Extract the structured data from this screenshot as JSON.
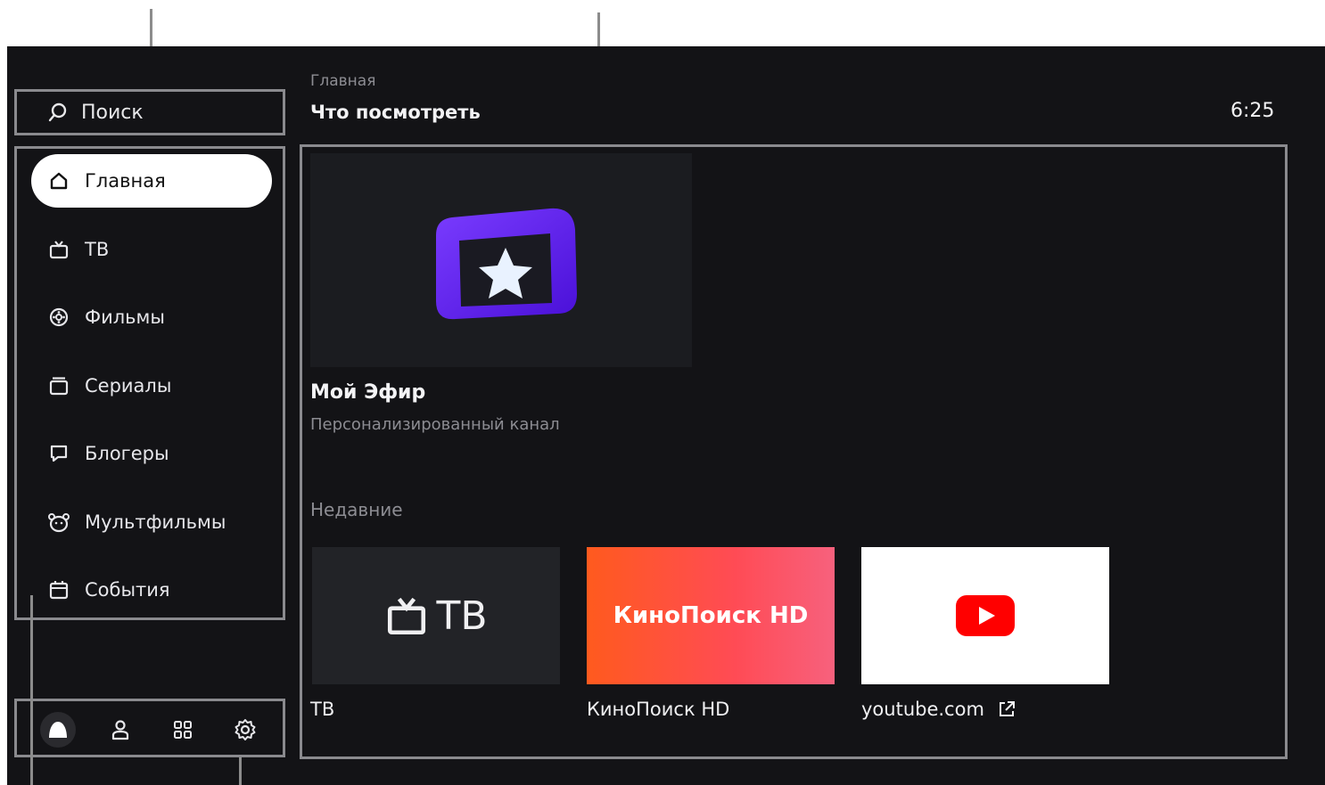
{
  "header": {
    "breadcrumb": "Главная",
    "title": "Что посмотреть",
    "clock": "6:25"
  },
  "search": {
    "label": "Поиск",
    "icon": "search-icon"
  },
  "sidebar": {
    "items": [
      {
        "label": "Главная",
        "icon": "home-icon",
        "active": true
      },
      {
        "label": "ТВ",
        "icon": "tv-icon"
      },
      {
        "label": "Фильмы",
        "icon": "film-reel-icon"
      },
      {
        "label": "Сериалы",
        "icon": "series-icon"
      },
      {
        "label": "Блогеры",
        "icon": "chat-bubble-icon"
      },
      {
        "label": "Мультфильмы",
        "icon": "bear-face-icon"
      },
      {
        "label": "События",
        "icon": "calendar-icon"
      }
    ]
  },
  "bottom_bar": {
    "buttons": [
      "account-avatar-icon",
      "profile-icon",
      "apps-grid-icon",
      "settings-gear-icon"
    ]
  },
  "featured": {
    "title": "Мой Эфир",
    "subtitle": "Персонализированный канал",
    "icon": "my-efir-star-icon"
  },
  "recent": {
    "section_title": "Недавние",
    "items": [
      {
        "tile_text": "ТВ",
        "label": "ТВ"
      },
      {
        "tile_text": "КиноПоиск HD",
        "label": "КиноПоиск HD"
      },
      {
        "label": "youtube.com",
        "icon": "external-link-icon"
      }
    ]
  },
  "colors": {
    "background": "#131316",
    "accent_purple": "#6a2cf5",
    "kinopoisk_orange": "#ff5a1e",
    "kinopoisk_pink": "#f7617d",
    "youtube_red": "#ff0000"
  }
}
